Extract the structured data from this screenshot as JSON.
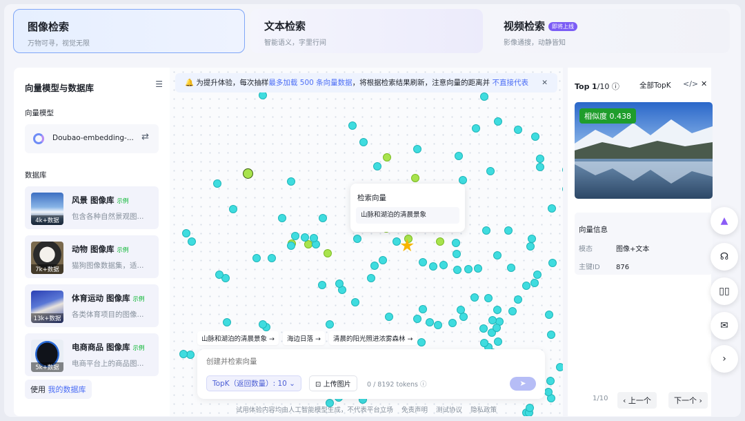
{
  "tabs": [
    {
      "title": "图像检索",
      "subtitle": "万物可寻，视觉无限"
    },
    {
      "title": "文本检索",
      "subtitle": "智能语义，字里行间"
    },
    {
      "title": "视频检索",
      "subtitle": "影像通搜，动静皆知",
      "badge": "即将上线"
    }
  ],
  "sidebar": {
    "title": "向量模型与数据库",
    "model_section": "向量模型",
    "model_name": "Doubao-embedding-...",
    "db_section": "数据库",
    "databases": [
      {
        "name": "风景 图像库",
        "tag": "示例",
        "desc": "包含各种自然景观图...",
        "count": "4k+数据"
      },
      {
        "name": "动物 图像库",
        "tag": "示例",
        "desc": "猫狗图像数据集，适...",
        "count": "7k+数据"
      },
      {
        "name": "体育运动 图像库",
        "tag": "示例",
        "desc": "各类体育项目的图像...",
        "count": "13k+数据"
      },
      {
        "name": "电商商品 图像库",
        "tag": "示例",
        "desc": "电商平台上的商品图...",
        "count": "5k+数据"
      }
    ],
    "use_prefix": "使用",
    "use_link": "我的数据库"
  },
  "notice": {
    "icon": "bell-icon",
    "pre": "为提升体验，每次抽样",
    "highlight": "最多加载 500 条向量数据",
    "mid": "，将根据检索结果刷新，注意向量的距离并",
    "link": "不直接代表"
  },
  "popup": {
    "title": "检索向量",
    "query": "山脉和湖泊的清晨景象"
  },
  "suggestions": [
    "山脉和湖泊的清晨景象",
    "海边日落",
    "清晨的阳光照进浓雾森林"
  ],
  "input": {
    "placeholder": "创建并检索向量",
    "topk_label": "TopK（返回数量）: 10",
    "upload_label": "上传图片",
    "tokens": "0 / 8192 tokens"
  },
  "footer": {
    "disclaimer": "试用体验内容均由人工智能模型生成，不代表平台立场",
    "links": [
      "免责声明",
      "测试协议",
      "隐私政策"
    ]
  },
  "right": {
    "top_label": "Top",
    "top_rank": "1",
    "top_total": "/10",
    "all_topk": "全部TopK",
    "similarity": "相似度 0.438",
    "info_title": "向量信息",
    "modality_key": "模态",
    "modality_val": "图像+文本",
    "pk_key": "主键ID",
    "pk_val": "876",
    "page": "1/10",
    "prev": "上一个",
    "next": "下一个"
  },
  "colors": {
    "accent": "#4c6ef5",
    "dot": "#3fdcdf",
    "match": "#a8e34d",
    "similarity": "#1f9d2c"
  }
}
